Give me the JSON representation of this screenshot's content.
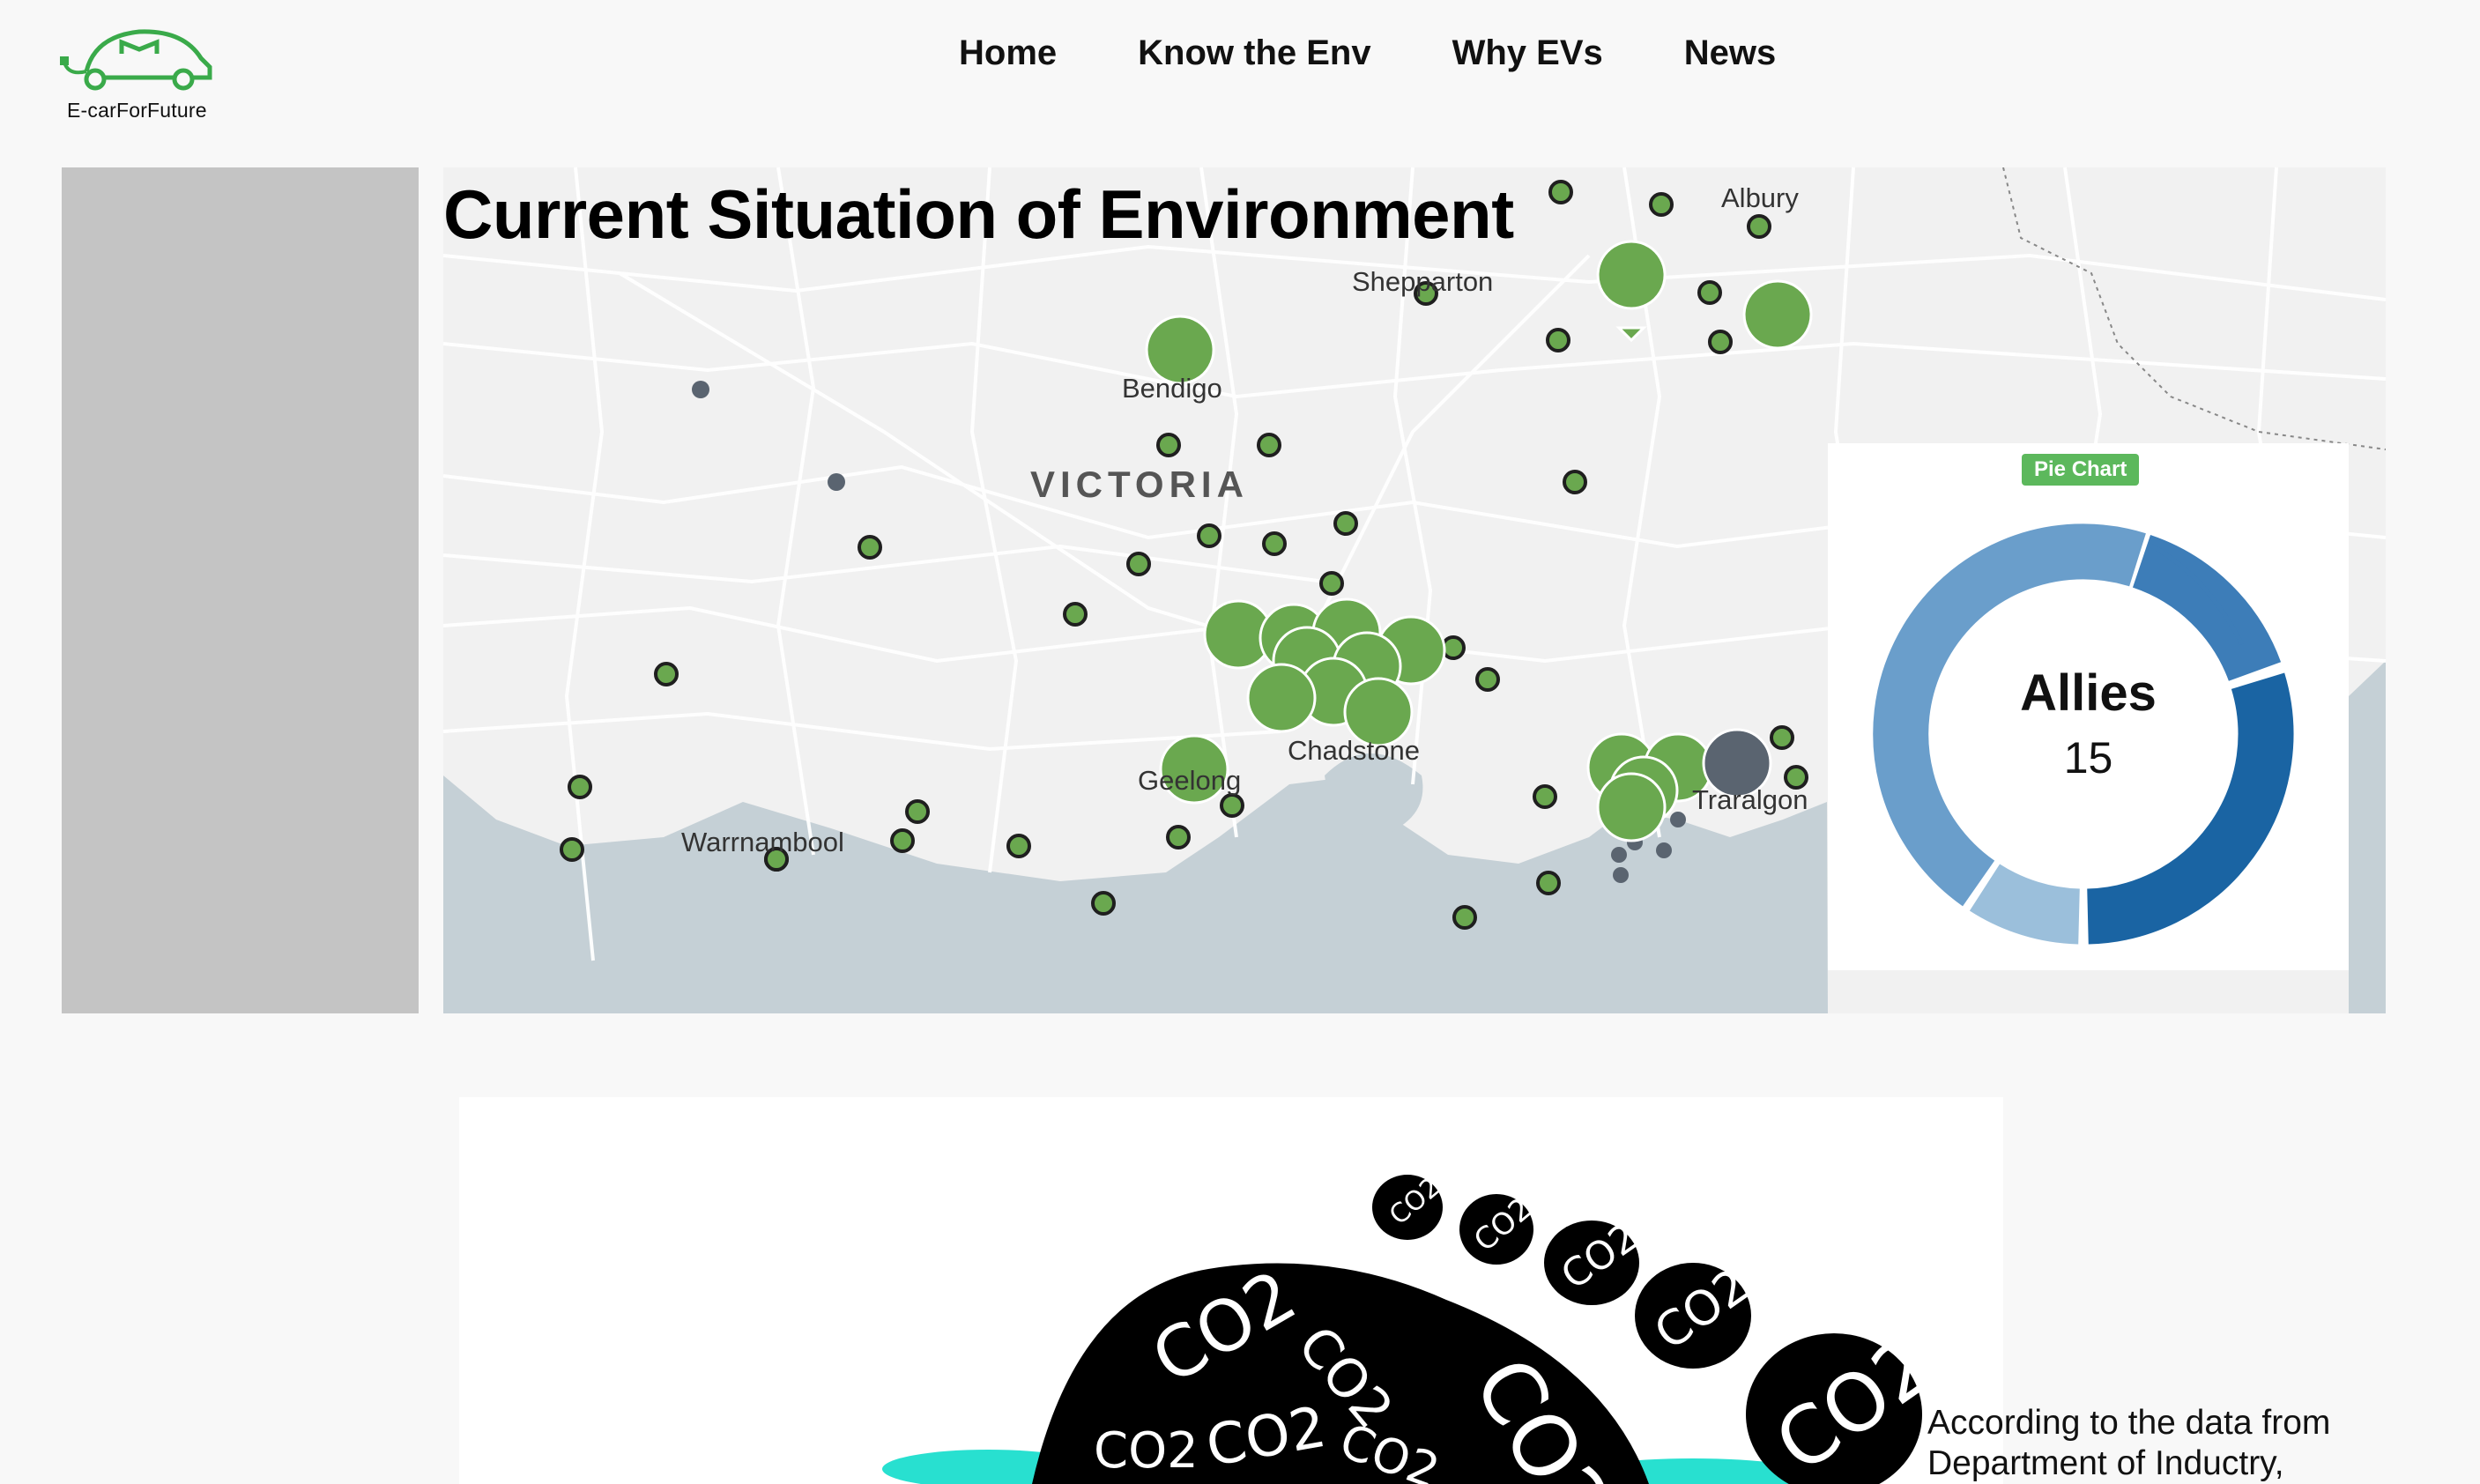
{
  "header": {
    "logo_text": "E-carForFuture",
    "nav": [
      "Home",
      "Know the Env",
      "Why EVs",
      "News"
    ]
  },
  "map": {
    "title": "Current Situation of Environment",
    "places": {
      "albury": "Albury",
      "shepparton": "Shepparton",
      "bendigo": "Bendigo",
      "victoria": "VICTORIA",
      "chadstone": "Chadstone",
      "geelong": "Geelong",
      "warrnambool": "Warrnambool",
      "traralgon": "Traralgon"
    },
    "marker_color": "#6aa84f",
    "grey_marker_color": "#5a6470",
    "sea_color": "#c5d0d6"
  },
  "pie": {
    "badge": "Pie Chart",
    "center_label": "Allies",
    "center_value": "15",
    "segment_colors": [
      "#6a9ecb",
      "#3d7db8",
      "#1a64a3",
      "#9bbfdb"
    ]
  },
  "footprint": {
    "symbol": "CO2",
    "text": "According to the data from Department of Inductry,"
  }
}
